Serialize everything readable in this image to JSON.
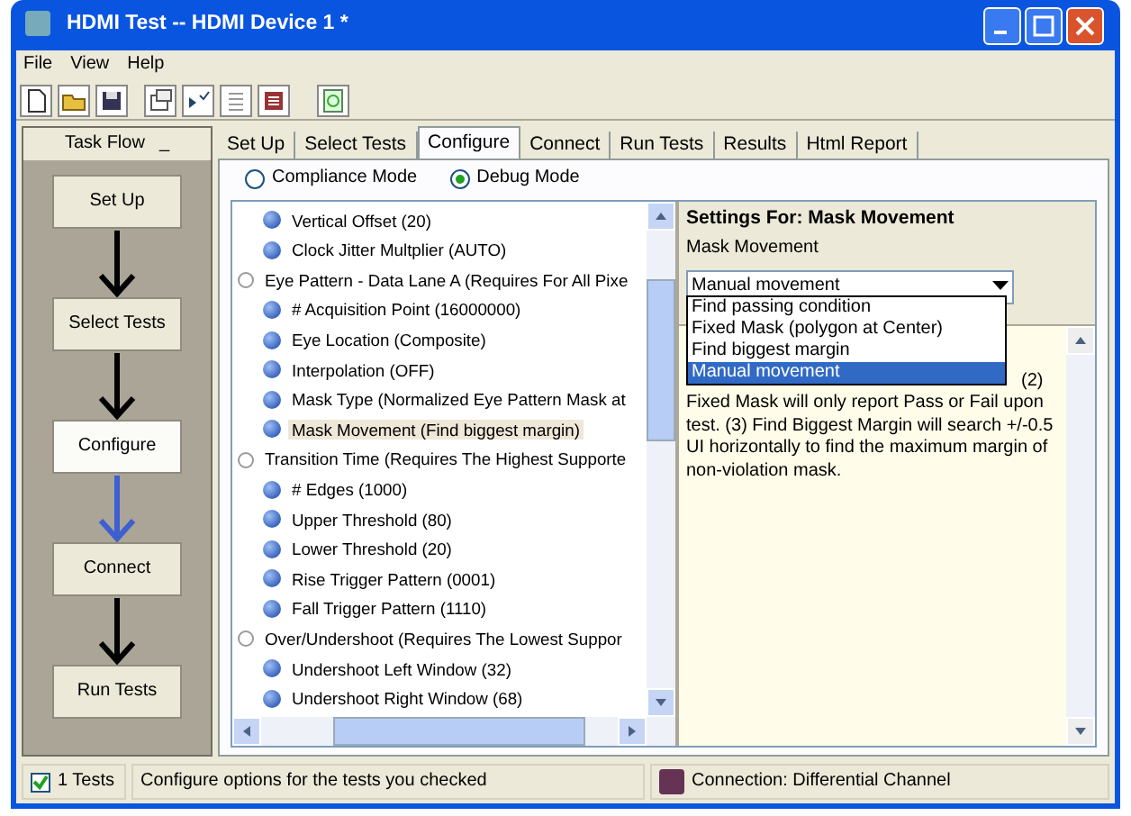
{
  "window": {
    "title": "HDMI Test -- HDMI Device 1 *"
  },
  "menu": [
    "File",
    "View",
    "Help"
  ],
  "task_flow": {
    "title": "Task Flow",
    "minimize": "_",
    "steps": [
      {
        "label": "Set Up",
        "selected": false
      },
      {
        "label": "Select Tests",
        "selected": false
      },
      {
        "label": "Configure",
        "selected": true
      },
      {
        "label": "Connect",
        "selected": false
      },
      {
        "label": "Run Tests",
        "selected": false
      }
    ]
  },
  "tabs": [
    {
      "label": "Set Up",
      "selected": false
    },
    {
      "label": "Select Tests",
      "selected": false
    },
    {
      "label": "Configure",
      "selected": true
    },
    {
      "label": "Connect",
      "selected": false
    },
    {
      "label": "Run Tests",
      "selected": false
    },
    {
      "label": "Results",
      "selected": false
    },
    {
      "label": "Html Report",
      "selected": false
    }
  ],
  "modes": [
    {
      "label": "Compliance Mode",
      "selected": false
    },
    {
      "label": "Debug Mode",
      "selected": true
    }
  ],
  "tree": [
    {
      "children": [
        {
          "label": "Vertical Offset (20)",
          "selected": false
        },
        {
          "label": "Clock Jitter Multplier (AUTO)",
          "selected": false
        }
      ]
    },
    {
      "label": "Eye Pattern - Data Lane A (Requires For All Pixe",
      "children": [
        {
          "label": "# Acquisition Point (16000000)",
          "selected": false
        },
        {
          "label": "Eye Location (Composite)",
          "selected": false
        },
        {
          "label": "Interpolation (OFF)",
          "selected": false
        },
        {
          "label": "Mask Type (Normalized Eye Pattern Mask at",
          "selected": false
        },
        {
          "label": "Mask Movement (Find biggest margin)",
          "selected": true
        }
      ]
    },
    {
      "label": "Transition Time (Requires The Highest Supporte",
      "children": [
        {
          "label": "# Edges (1000)",
          "selected": false
        },
        {
          "label": "Upper Threshold  (80)",
          "selected": false
        },
        {
          "label": "Lower Threshold (20)",
          "selected": false
        },
        {
          "label": "Rise Trigger Pattern (0001)",
          "selected": false
        },
        {
          "label": "Fall Trigger Pattern (1110)",
          "selected": false
        }
      ]
    },
    {
      "label": "Over/Undershoot (Requires The Lowest Suppor",
      "children": [
        {
          "label": "Undershoot Left Window (32)",
          "selected": false
        },
        {
          "label": "Undershoot Right Window (68)",
          "selected": false
        }
      ]
    }
  ],
  "settings": {
    "title": "Settings For: Mask Movement",
    "field_label": "Mask Movement",
    "value": "Manual movement",
    "options": [
      {
        "label": "Find passing condition",
        "selected": false
      },
      {
        "label": "Fixed Mask (polygon at Center)",
        "selected": false
      },
      {
        "label": "Find biggest margin",
        "selected": false
      },
      {
        "label": "Manual movement",
        "selected": true
      }
    ],
    "description_start": "(2)",
    "description": "Fixed Mask will only report Pass or Fail upon test. (3) Find Biggest Margin will search +/-0.5 UI horizontally to find the maximum margin of non-violation mask."
  },
  "status_bar": {
    "tests_checked": true,
    "tests": "1 Tests",
    "message": "Configure options for the tests you checked",
    "connection": "Connection: Differential Channel"
  }
}
